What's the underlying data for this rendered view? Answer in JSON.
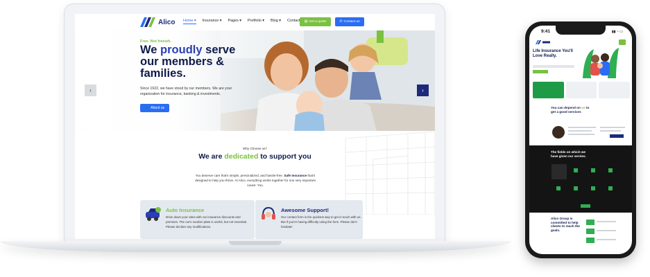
{
  "site": {
    "brand": "Alico",
    "nav": {
      "items": [
        "Home ▾",
        "Insurance ▾",
        "Pages ▾",
        "Portfolio ▾",
        "Blog ▾",
        "Contact"
      ],
      "quote_label": "Get a quote",
      "contact_label": "Contact us"
    },
    "hero": {
      "tagline": "Free. Not freeish.",
      "title_pre": "We",
      "title_highlight": "proudly",
      "title_post": "serve our members & families.",
      "description": "Since 1922, we have stood by our members. We are your organization for insurance, banking & investments.",
      "button_label": "About us"
    },
    "why": {
      "eyebrow": "Why Choose us?",
      "title_pre": "We are",
      "title_highlight": "dedicated",
      "title_post": "to support you",
      "desc_pre": "You deserve care that's simple, personalized, and hassle-free.",
      "desc_bold": "Safe Insurance",
      "desc_post": "that's designed to help you thrive. At Alico, everything works together for one very important cause: You."
    },
    "cards": [
      {
        "title": "Auto Insurance",
        "text": "Drive down your rates with car insurance discounts and premium. The car's number plate is useful, but not essential. Please declare any modifications."
      },
      {
        "title": "Awesome Support!",
        "text": "Our contact form is the quickest way to get in touch with us. But if you're having difficulty using the form. Please don't hesitate!"
      }
    ]
  },
  "phone": {
    "time": "9:41",
    "hero_title": "Life Insurance You'll Love Really.",
    "sub_pre": "You can depend on",
    "sub_highlight": "us",
    "sub_post": "to get a good services",
    "dark_title": "The fields on which we have given our servies.",
    "last_title": "Alico Group is committed to help clients to reach the goals."
  },
  "colors": {
    "brand_navy": "#0f1a4a",
    "brand_blue": "#2a6df4",
    "brand_green": "#7ac142"
  }
}
